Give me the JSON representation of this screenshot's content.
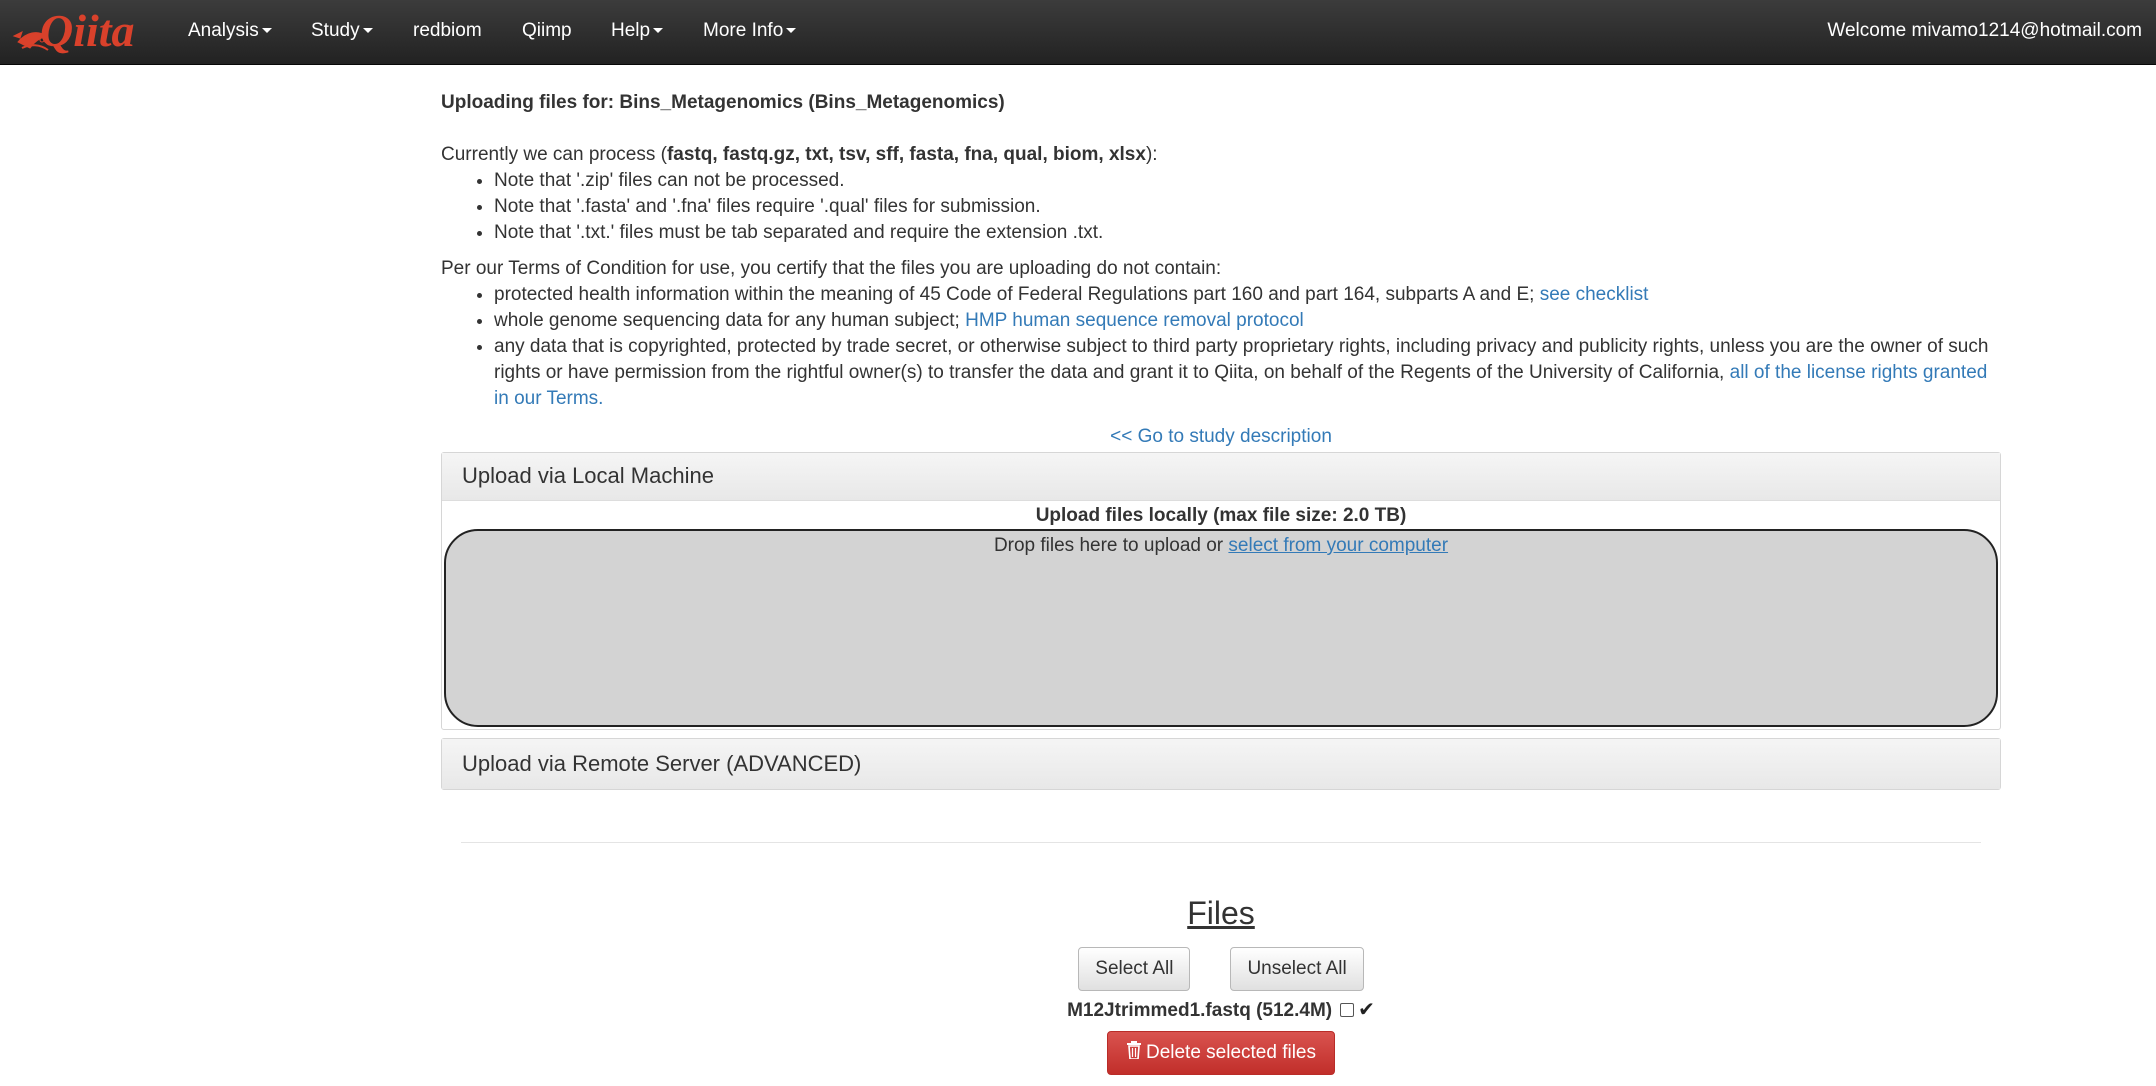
{
  "navbar": {
    "brand": "Qiita",
    "items": [
      {
        "label": "Analysis",
        "dropdown": true
      },
      {
        "label": "Study",
        "dropdown": true
      },
      {
        "label": "redbiom",
        "dropdown": false
      },
      {
        "label": "Qiimp",
        "dropdown": false
      },
      {
        "label": "Help",
        "dropdown": true
      },
      {
        "label": "More Info",
        "dropdown": true
      }
    ],
    "welcome": "Welcome mivamo1214@hotmail.com"
  },
  "page": {
    "title": "Uploading files for: Bins_Metagenomics (Bins_Metagenomics)",
    "process_prefix": "Currently we can process (",
    "process_formats": "fastq, fastq.gz, txt, tsv, sff, fasta, fna, qual, biom, xlsx",
    "process_suffix": "):",
    "notes": [
      "Note that '.zip' files can not be processed.",
      "Note that '.fasta' and '.fna' files require '.qual' files for submission.",
      "Note that '.txt.' files must be tab separated and require the extension .txt."
    ],
    "terms_intro": "Per our Terms of Condition for use, you certify that the files you are uploading do not contain:",
    "terms": [
      {
        "text": "protected health information within the meaning of 45 Code of Federal Regulations part 160 and part 164, subparts A and E; ",
        "link": "see checklist"
      },
      {
        "text": "whole genome sequencing data for any human subject; ",
        "link": "HMP human sequence removal protocol"
      },
      {
        "text": "any data that is copyrighted, protected by trade secret, or otherwise subject to third party proprietary rights, including privacy and publicity rights, unless you are the owner of such rights or have permission from the rightful owner(s) to transfer the data and grant it to Qiita, on behalf of the Regents of the University of California, ",
        "link": "all of the license rights granted in our Terms."
      }
    ],
    "goto_study": "<< Go to study description"
  },
  "local_upload": {
    "heading": "Upload via Local Machine",
    "max_note": "Upload files locally (max file size: 2.0 TB)",
    "drop_text": "Drop files here to upload or ",
    "select_link": "select from your computer"
  },
  "remote_upload": {
    "heading": "Upload via Remote Server (ADVANCED)"
  },
  "files": {
    "title": "Files",
    "select_all": "Select All",
    "unselect_all": "Unselect All",
    "items": [
      {
        "name": "M12Jtrimmed1.fastq (512.4M)",
        "checked": false
      }
    ],
    "delete_label": "Delete selected files"
  },
  "colors": {
    "navbar_bg": "#222222",
    "brand": "#d9412b",
    "link": "#337ab7",
    "danger": "#d9534f",
    "dropzone_bg": "#d3d3d3"
  }
}
